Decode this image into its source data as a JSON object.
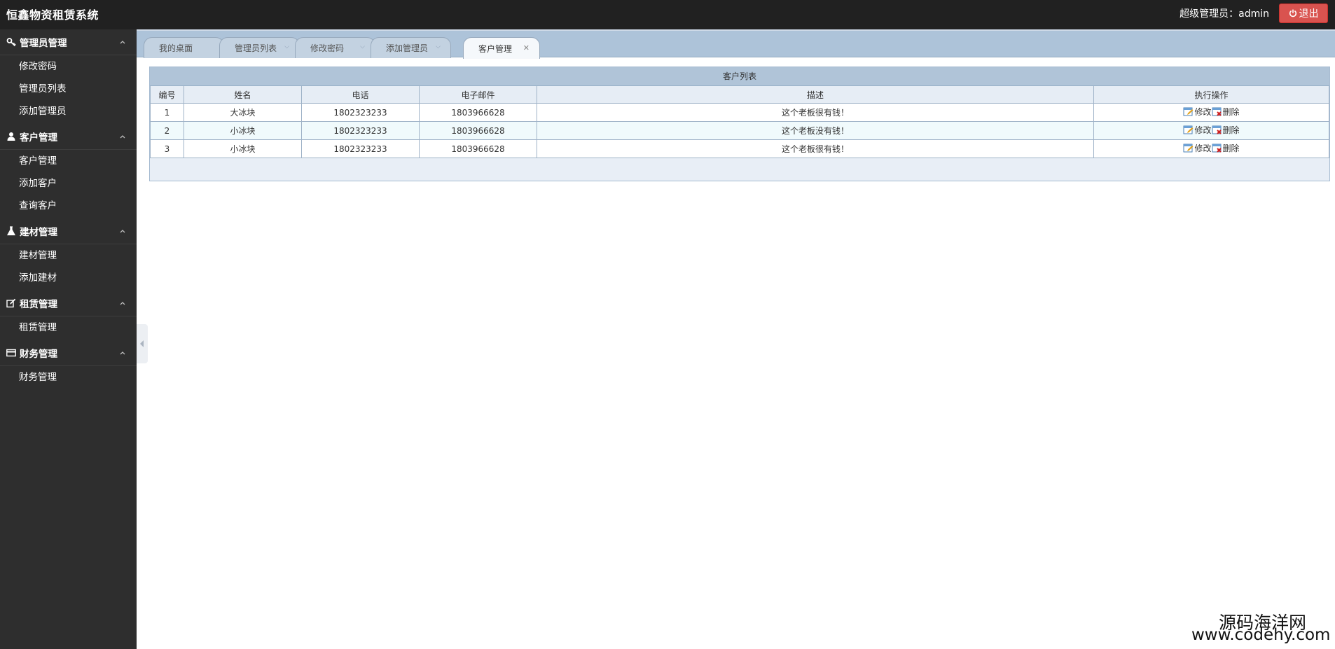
{
  "header": {
    "title": "恒鑫物资租赁系统",
    "user_label": "超级管理员：admin",
    "logout_label": "退出",
    "logout_color": "#d9534f"
  },
  "sidebar": {
    "sections": [
      {
        "title": "管理员管理",
        "icon": "key-icon",
        "items": [
          "修改密码",
          "管理员列表",
          "添加管理员"
        ]
      },
      {
        "title": "客户管理",
        "icon": "user-icon",
        "items": [
          "客户管理",
          "添加客户",
          "查询客户"
        ]
      },
      {
        "title": "建材管理",
        "icon": "flask-icon",
        "items": [
          "建材管理",
          "添加建材"
        ]
      },
      {
        "title": "租赁管理",
        "icon": "edit-icon",
        "items": [
          "租赁管理"
        ]
      },
      {
        "title": "财务管理",
        "icon": "card-icon",
        "items": [
          "财务管理"
        ]
      }
    ]
  },
  "tabs": [
    {
      "label": "我的桌面",
      "active": false
    },
    {
      "label": "管理员列表",
      "active": false
    },
    {
      "label": "修改密码",
      "active": false
    },
    {
      "label": "添加管理员",
      "active": false
    },
    {
      "label": "客户管理",
      "active": true
    }
  ],
  "table": {
    "title": "客户列表",
    "columns": [
      "编号",
      "姓名",
      "电话",
      "电子邮件",
      "描述",
      "执行操作"
    ],
    "rows": [
      {
        "id": "1",
        "name": "大冰块",
        "phone": "1802323233",
        "email": "1803966628",
        "desc": "这个老板很有钱！"
      },
      {
        "id": "2",
        "name": "小冰块",
        "phone": "1802323233",
        "email": "1803966628",
        "desc": "这个老板没有钱！"
      },
      {
        "id": "3",
        "name": "小冰块",
        "phone": "1802323233",
        "email": "1803966628",
        "desc": "这个老板很有钱！"
      }
    ],
    "edit_label": "修改",
    "delete_label": "删除"
  },
  "watermark": {
    "line1": "源码海洋网",
    "line2": "www.codehy.com"
  }
}
